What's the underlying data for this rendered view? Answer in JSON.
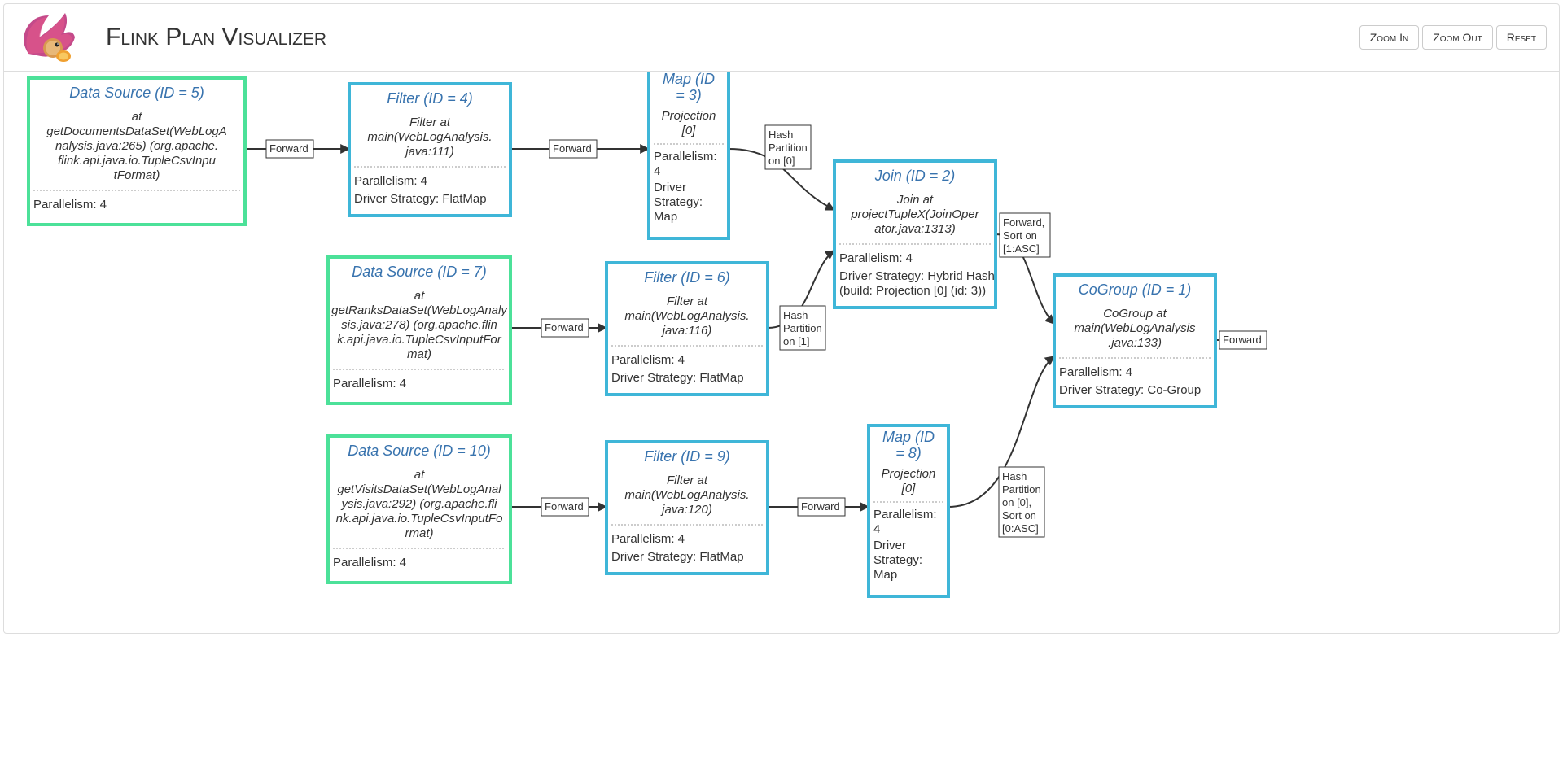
{
  "header": {
    "title": "Flink Plan Visualizer",
    "buttons": {
      "zoom_in": "Zoom In",
      "zoom_out": "Zoom Out",
      "reset": "Reset"
    }
  },
  "nodes": {
    "n5": {
      "title": "Data Source (ID = 5)",
      "desc": [
        "at",
        "getDocumentsDataSet(WebLogA",
        "nalysis.java:265) (org.apache.",
        "flink.api.java.io.TupleCsvInpu",
        "tFormat)"
      ],
      "meta": [
        "Parallelism: 4"
      ]
    },
    "n4": {
      "title": "Filter (ID = 4)",
      "desc": [
        "Filter at",
        "main(WebLogAnalysis.",
        "java:111)"
      ],
      "meta": [
        "Parallelism: 4",
        "Driver Strategy: FlatMap"
      ]
    },
    "n3": {
      "title": [
        "Map (ID",
        "= 3)"
      ],
      "desc": [
        "Projection",
        "[0]"
      ],
      "meta": [
        "Parallelism:",
        "4",
        "Driver",
        "Strategy:",
        "Map"
      ]
    },
    "n7": {
      "title": "Data Source (ID = 7)",
      "desc": [
        "at",
        "getRanksDataSet(WebLogAnaly",
        "sis.java:278) (org.apache.flin",
        "k.api.java.io.TupleCsvInputFor",
        "mat)"
      ],
      "meta": [
        "Parallelism: 4"
      ]
    },
    "n6": {
      "title": "Filter (ID = 6)",
      "desc": [
        "Filter at",
        "main(WebLogAnalysis.",
        "java:116)"
      ],
      "meta": [
        "Parallelism: 4",
        "Driver Strategy: FlatMap"
      ]
    },
    "n2": {
      "title": "Join (ID = 2)",
      "desc": [
        "Join at",
        "projectTupleX(JoinOper",
        "ator.java:1313)"
      ],
      "meta": [
        "Parallelism: 4",
        "Driver Strategy: Hybrid Hash",
        "(build: Projection [0] (id: 3))"
      ]
    },
    "n10": {
      "title": "Data Source (ID = 10)",
      "desc": [
        "at",
        "getVisitsDataSet(WebLogAnal",
        "ysis.java:292) (org.apache.fli",
        "nk.api.java.io.TupleCsvInputFo",
        "rmat)"
      ],
      "meta": [
        "Parallelism: 4"
      ]
    },
    "n9": {
      "title": "Filter (ID = 9)",
      "desc": [
        "Filter at",
        "main(WebLogAnalysis.",
        "java:120)"
      ],
      "meta": [
        "Parallelism: 4",
        "Driver Strategy: FlatMap"
      ]
    },
    "n8": {
      "title": [
        "Map (ID",
        "= 8)"
      ],
      "desc": [
        "Projection",
        "[0]"
      ],
      "meta": [
        "Parallelism:",
        "4",
        "Driver",
        "Strategy:",
        "Map"
      ]
    },
    "n1": {
      "title": "CoGroup (ID = 1)",
      "desc": [
        "CoGroup at",
        "main(WebLogAnalysis",
        ".java:133)"
      ],
      "meta": [
        "Parallelism: 4",
        "Driver Strategy: Co-Group"
      ]
    }
  },
  "edges": {
    "e5_4": [
      "Forward"
    ],
    "e4_3": [
      "Forward"
    ],
    "e3_2": [
      "Hash",
      "Partition",
      "on [0]"
    ],
    "e7_6": [
      "Forward"
    ],
    "e6_2": [
      "Hash",
      "Partition",
      "on [1]"
    ],
    "e2_1": [
      "Forward,",
      "Sort on",
      "[1:ASC]"
    ],
    "e10_9": [
      "Forward"
    ],
    "e9_8": [
      "Forward"
    ],
    "e8_1": [
      "Hash",
      "Partition",
      "on [0],",
      "Sort on",
      "[0:ASC]"
    ],
    "e1_out": [
      "Forward"
    ]
  }
}
